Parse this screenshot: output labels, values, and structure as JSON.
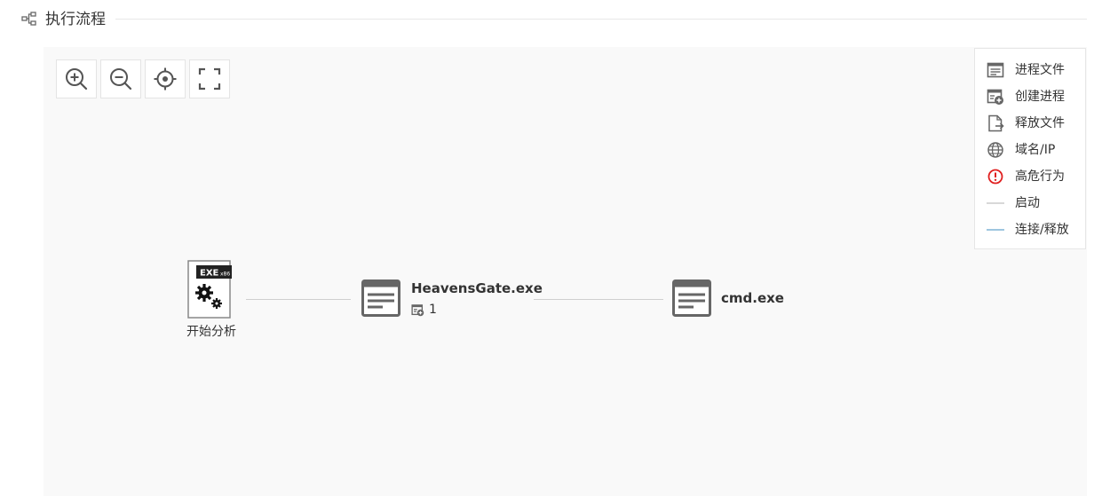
{
  "section": {
    "title": "执行流程"
  },
  "toolbar": {
    "zoom_in": "zoom-in-icon",
    "zoom_out": "zoom-out-icon",
    "locate": "crosshair-icon",
    "fullscreen": "fullscreen-icon"
  },
  "legend": {
    "items": [
      {
        "label": "进程文件",
        "icon": "process-file-icon"
      },
      {
        "label": "创建进程",
        "icon": "create-process-icon"
      },
      {
        "label": "释放文件",
        "icon": "release-file-icon"
      },
      {
        "label": "域名/IP",
        "icon": "globe-icon"
      },
      {
        "label": "高危行为",
        "icon": "warning-icon"
      },
      {
        "label": "启动",
        "icon": "start-line",
        "color": "#cccccc"
      },
      {
        "label": "连接/释放",
        "icon": "connect-line",
        "color": "#7fb3d5"
      }
    ]
  },
  "graph": {
    "start_node": {
      "label": "开始分析",
      "badge": "EXE",
      "badge_sub": "x86"
    },
    "processes": [
      {
        "name": "HeavensGate.exe",
        "child_count": "1"
      },
      {
        "name": "cmd.exe"
      }
    ]
  },
  "colors": {
    "icon_gray": "#666666",
    "warning_red": "#e02020",
    "edge_gray": "#cfcfcf",
    "connect_blue": "#7fb3d5",
    "canvas_bg": "#f9f9f9"
  }
}
